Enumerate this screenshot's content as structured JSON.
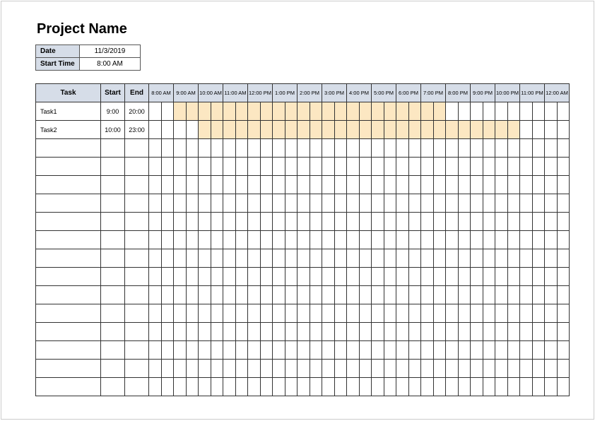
{
  "title": "Project Name",
  "meta": {
    "date_label": "Date",
    "date_value": "11/3/2019",
    "start_time_label": "Start Time",
    "start_time_value": "8:00 AM"
  },
  "headers": {
    "task": "Task",
    "start": "Start",
    "end": "End",
    "hours": [
      "8:00 AM",
      "9:00 AM",
      "10:00 AM",
      "11:00 AM",
      "12:00 PM",
      "1:00 PM",
      "2:00 PM",
      "3:00 PM",
      "4:00 PM",
      "5:00 PM",
      "6:00 PM",
      "7:00 PM",
      "8:00 PM",
      "9:00 PM",
      "10:00 PM",
      "11:00 PM",
      "12:00 AM"
    ]
  },
  "tasks": [
    {
      "name": "Task1",
      "start": "9:00",
      "end": "20:00",
      "from_slot": 2,
      "to_slot": 24
    },
    {
      "name": "Task2",
      "start": "10:00",
      "end": "23:00",
      "from_slot": 4,
      "to_slot": 30
    }
  ],
  "empty_rows": 14,
  "slots_per_row": 34
}
